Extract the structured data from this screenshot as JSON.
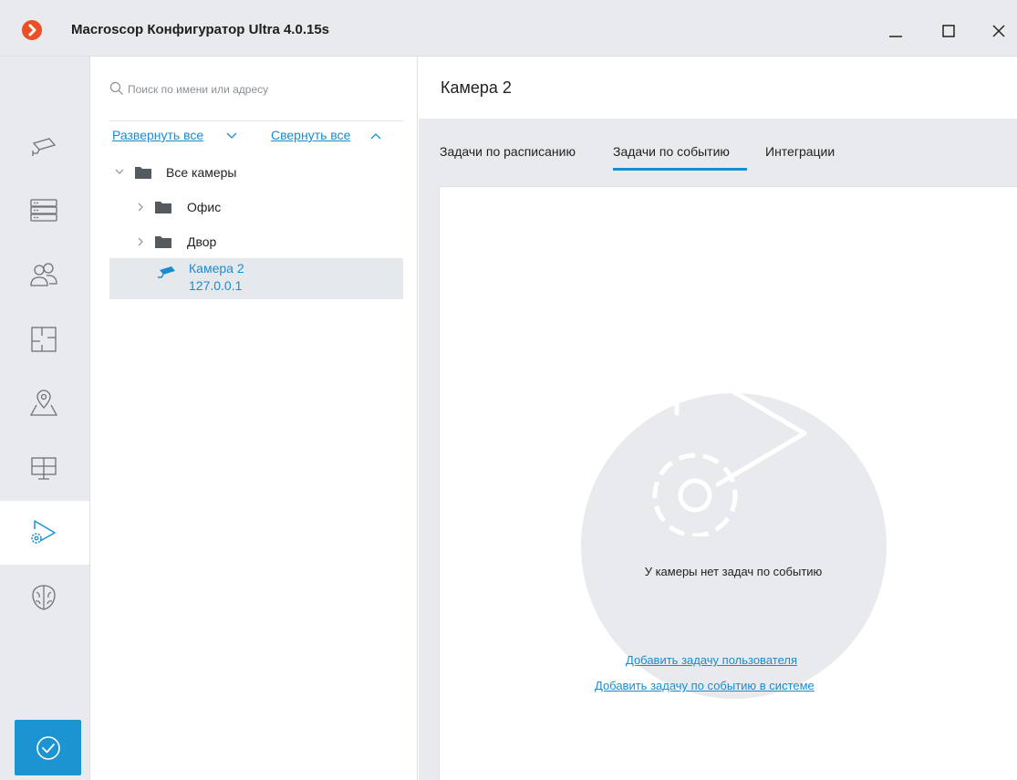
{
  "window": {
    "title": "Macroscop Конфигуратор Ultra 4.0.15s",
    "logo_color": "#ea4f25"
  },
  "rail": {
    "items": [
      {
        "name": "cameras",
        "icon": "camera-icon"
      },
      {
        "name": "servers",
        "icon": "server-icon"
      },
      {
        "name": "users",
        "icon": "users-icon"
      },
      {
        "name": "layouts",
        "icon": "layout-plan-icon"
      },
      {
        "name": "maps",
        "icon": "map-pin-icon"
      },
      {
        "name": "monitors",
        "icon": "monitor-grid-icon"
      },
      {
        "name": "tasks",
        "icon": "tasks-icon",
        "active": true
      },
      {
        "name": "ai",
        "icon": "brain-icon"
      }
    ],
    "apply_icon": "check-circle-icon",
    "accent": "#1d94d2"
  },
  "tree": {
    "search_placeholder": "Поиск по имени или адресу",
    "expand_all": "Развернуть все",
    "collapse_all": "Свернуть все",
    "root": "Все камеры",
    "folders": [
      "Офис",
      "Двор"
    ],
    "selected_camera": {
      "name": "Камера 2",
      "address": "127.0.0.1"
    }
  },
  "main": {
    "title": "Камера 2",
    "tabs": [
      {
        "label": "Задачи по расписанию",
        "active": false
      },
      {
        "label": "Задачи по событию",
        "active": true
      },
      {
        "label": "Интеграции",
        "active": false
      }
    ],
    "empty_message": "У камеры нет задач по событию",
    "add_user_task": "Добавить задачу пользователя",
    "add_system_task": "Добавить задачу по событию в системе"
  }
}
